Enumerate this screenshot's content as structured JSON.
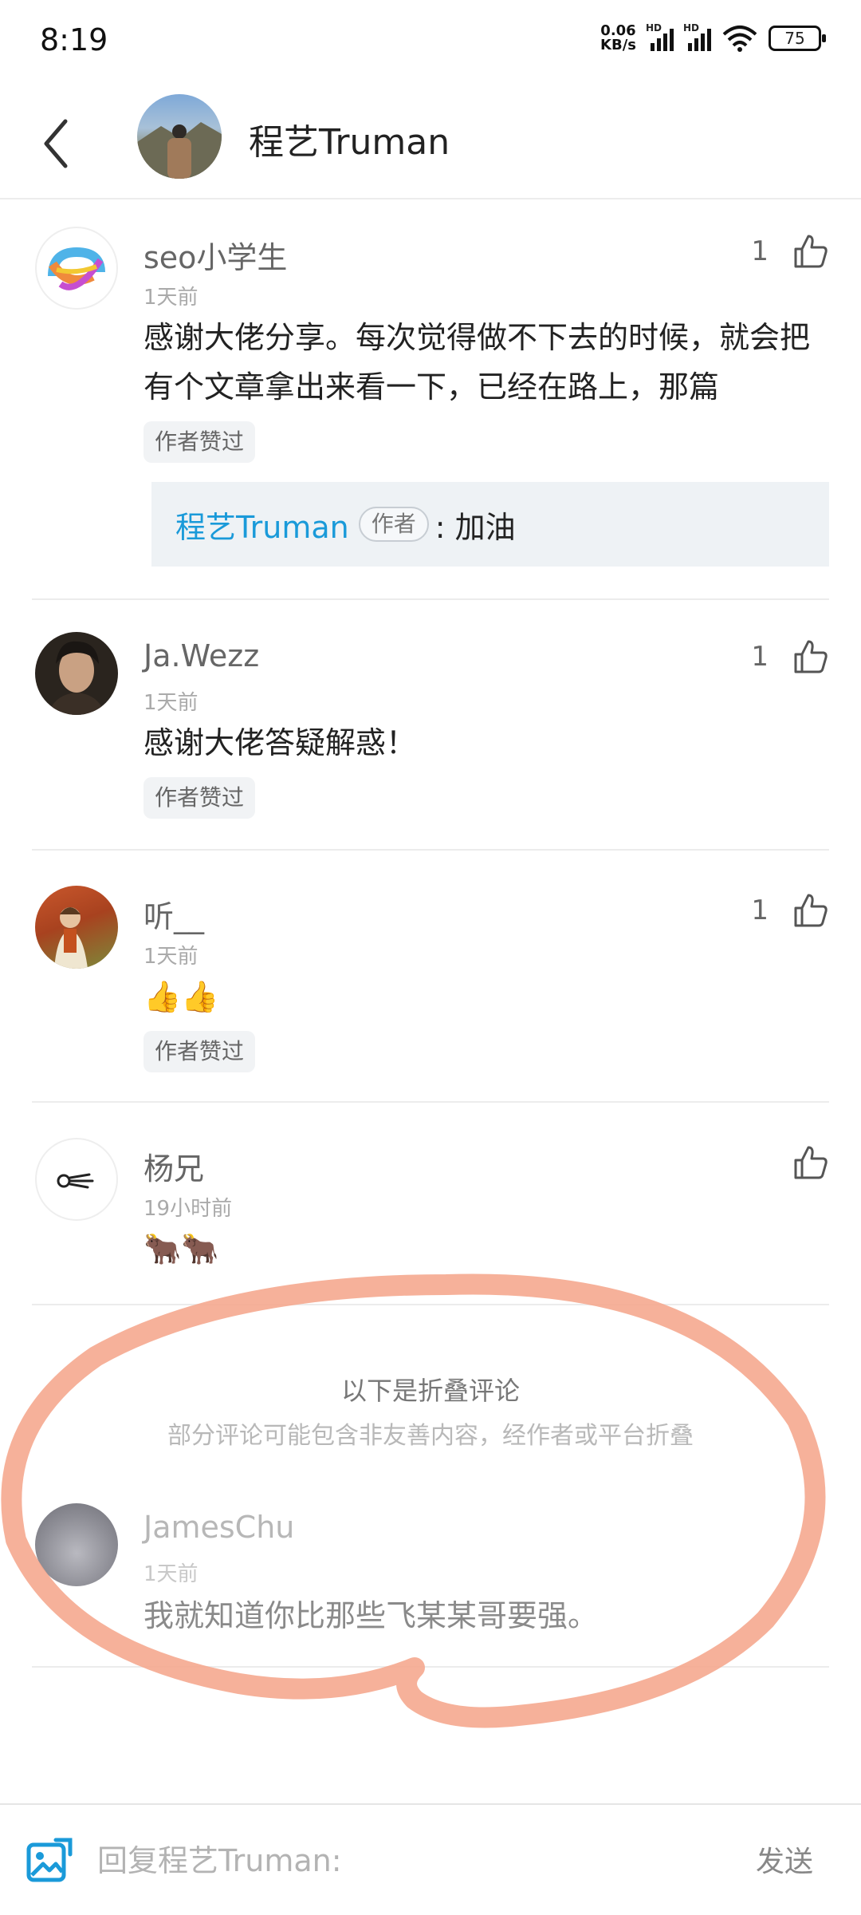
{
  "status_bar": {
    "time": "8:19",
    "net_speed_value": "0.06",
    "net_speed_unit": "KB/s",
    "hd_label": "HD",
    "battery": "75"
  },
  "header": {
    "title": "程艺Truman"
  },
  "comments": [
    {
      "name": "seo小学生",
      "time": "1天前",
      "body": "感谢大佬分享。每次觉得做不下去的时候，就会把有个文章拿出来看一下，已经在路上，那篇",
      "badge": "作者赞过",
      "likes": "1",
      "reply": {
        "author": "程艺Truman",
        "tag": "作者",
        "text": ": 加油"
      }
    },
    {
      "name": "Ja.Wezz",
      "time": "1天前",
      "body": "感谢大佬答疑解惑！",
      "badge": "作者赞过",
      "likes": "1"
    },
    {
      "name": "听__",
      "time": "1天前",
      "body": "👍👍",
      "badge": "作者赞过",
      "likes": "1"
    },
    {
      "name": "杨兄",
      "time": "19小时前",
      "body": "🐂🐂",
      "likes": ""
    }
  ],
  "folded": {
    "title": "以下是折叠评论",
    "subtitle": "部分评论可能包含非友善内容，经作者或平台折叠",
    "comment": {
      "name": "JamesChu",
      "time": "1天前",
      "body": "我就知道你比那些飞某某哥要强。"
    }
  },
  "bottom_bar": {
    "placeholder": "回复程艺Truman:",
    "send_label": "发送"
  },
  "colors": {
    "accent_link": "#1a9ad9",
    "annotation": "#f5a88f"
  }
}
